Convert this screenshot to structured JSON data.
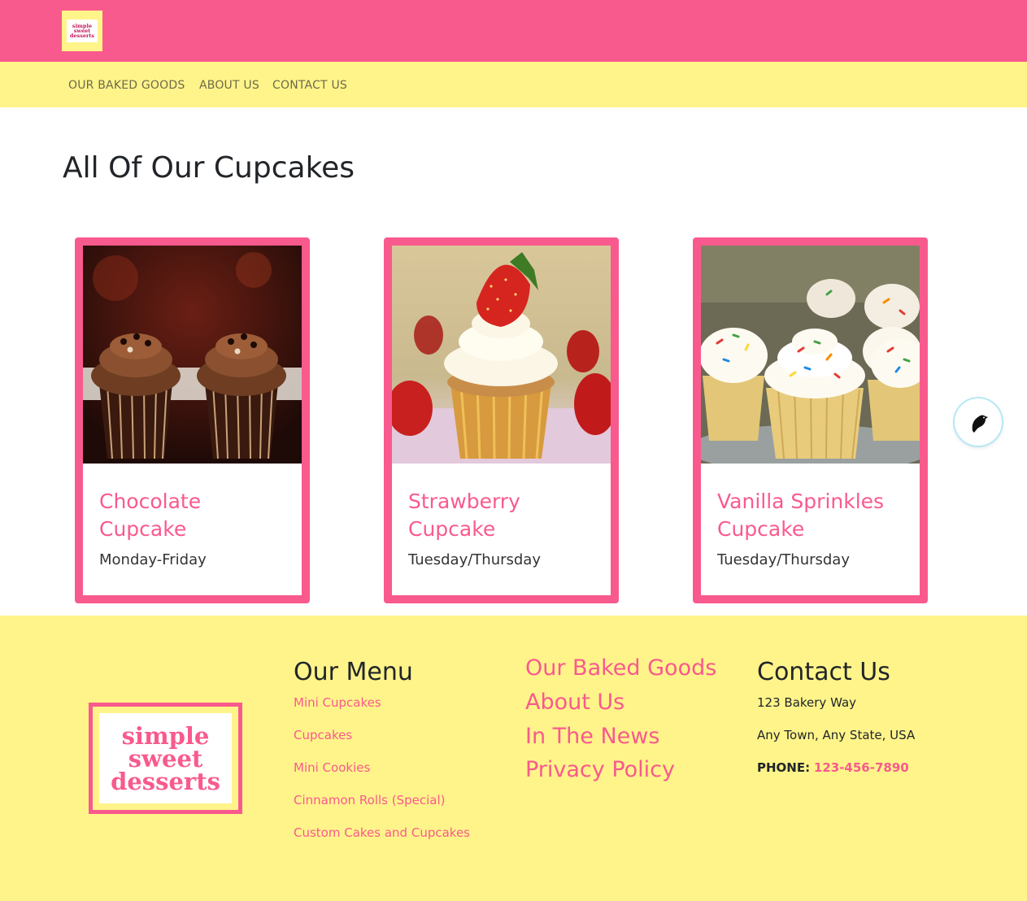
{
  "header": {
    "logo_lines": [
      "simple",
      "sweet",
      "desserts"
    ],
    "logo_icon": "simple-sweet-desserts-logo"
  },
  "nav": {
    "items": [
      {
        "label": "OUR BAKED GOODS"
      },
      {
        "label": "ABOUT US"
      },
      {
        "label": "CONTACT US"
      }
    ]
  },
  "main": {
    "title": "All Of Our Cupcakes",
    "cards": [
      {
        "title_line1": "Chocolate",
        "title_line2": "Cupcake",
        "days": "Monday-Friday",
        "image": "chocolate-cupcakes-photo"
      },
      {
        "title_line1": "Strawberry",
        "title_line2": "Cupcake",
        "days": "Tuesday/Thursday",
        "image": "strawberry-cupcake-photo"
      },
      {
        "title_line1": "Vanilla Sprinkles",
        "title_line2": "Cupcake",
        "days": "Tuesday/Thursday",
        "image": "vanilla-sprinkles-cupcakes-photo"
      }
    ]
  },
  "footer": {
    "logo_lines": [
      "simple",
      "sweet",
      "desserts"
    ],
    "menu": {
      "heading": "Our Menu",
      "items": [
        "Mini Cupcakes",
        "Cupcakes",
        "Mini Cookies",
        "Cinnamon Rolls (Special)",
        "Custom Cakes and Cupcakes"
      ]
    },
    "links": {
      "items": [
        "Our Baked Goods",
        "About Us",
        "In The News",
        "Privacy Policy"
      ]
    },
    "contact": {
      "heading": "Contact Us",
      "address1": "123 Bakery Way",
      "address2": "Any Town, Any State, USA",
      "phone_label": "PHONE:",
      "phone": "123-456-7890"
    }
  },
  "floating_button": {
    "icon": "bird-icon"
  },
  "colors": {
    "pink": "#f95a8d",
    "yellow": "#fff48a",
    "text": "#212529"
  }
}
